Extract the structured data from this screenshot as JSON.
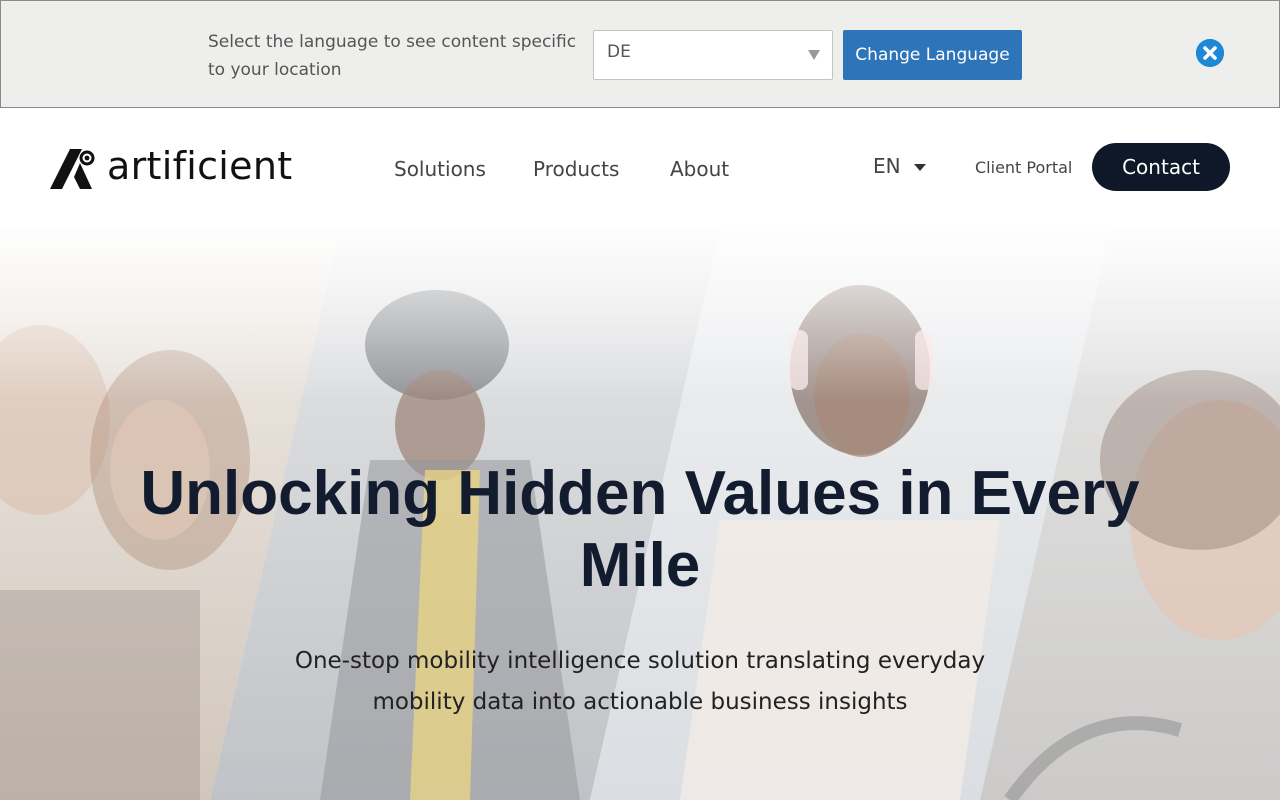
{
  "language_banner": {
    "prompt": "Select the language to see content specific to your location",
    "selected_language": "DE",
    "change_button_label": "Change Language",
    "accent_color": "#2d74b8"
  },
  "header": {
    "brand": "artificient",
    "nav": [
      {
        "label": "Solutions"
      },
      {
        "label": "Products"
      },
      {
        "label": "About"
      }
    ],
    "language": "EN",
    "client_portal_label": "Client Portal",
    "contact_label": "Contact",
    "contact_color": "#0f1828"
  },
  "hero": {
    "title": "Unlocking Hidden Values in Every Mile",
    "subtitle": "One-stop mobility intelligence solution translating everyday mobility data into actionable business insights"
  },
  "icons": {
    "close": "close-circle-icon",
    "select_caret": "caret-down-icon"
  }
}
